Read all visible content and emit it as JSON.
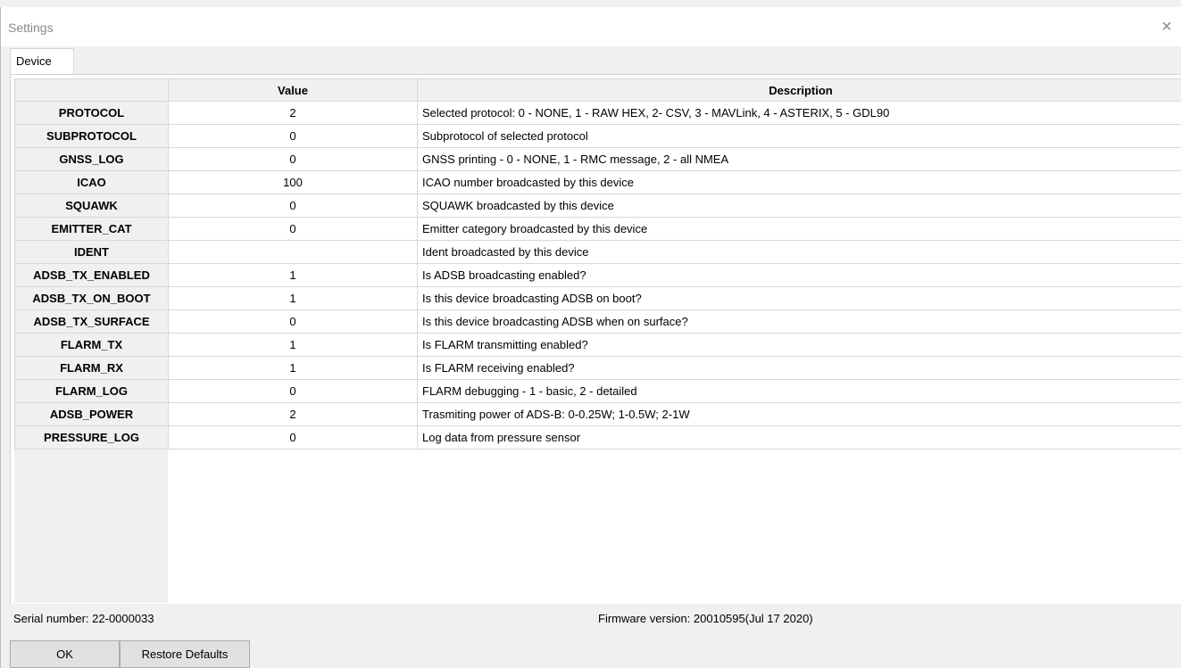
{
  "window": {
    "title": "Settings",
    "close_glyph": "×",
    "close_icon": "close-icon"
  },
  "tabs": [
    {
      "label": "Device",
      "selected": true
    }
  ],
  "table": {
    "columns": [
      "",
      "Value",
      "Description"
    ],
    "rows": [
      {
        "name": "PROTOCOL",
        "value": "2",
        "description": "Selected protocol: 0 - NONE, 1 - RAW HEX, 2- CSV, 3 - MAVLink, 4 - ASTERIX, 5 - GDL90"
      },
      {
        "name": "SUBPROTOCOL",
        "value": "0",
        "description": "Subprotocol of selected protocol"
      },
      {
        "name": "GNSS_LOG",
        "value": "0",
        "description": "GNSS printing - 0 - NONE, 1 - RMC message, 2 - all NMEA"
      },
      {
        "name": "ICAO",
        "value": "100",
        "description": "ICAO number broadcasted by this device"
      },
      {
        "name": "SQUAWK",
        "value": "0",
        "description": "SQUAWK broadcasted by this device"
      },
      {
        "name": "EMITTER_CAT",
        "value": "0",
        "description": "Emitter category broadcasted by this device"
      },
      {
        "name": "IDENT",
        "value": "",
        "description": "Ident broadcasted by this device"
      },
      {
        "name": "ADSB_TX_ENABLED",
        "value": "1",
        "description": "Is ADSB broadcasting enabled?"
      },
      {
        "name": "ADSB_TX_ON_BOOT",
        "value": "1",
        "description": "Is this device broadcasting ADSB on boot?"
      },
      {
        "name": "ADSB_TX_SURFACE",
        "value": "0",
        "description": "Is this device broadcasting ADSB when on surface?"
      },
      {
        "name": "FLARM_TX",
        "value": "1",
        "description": "Is FLARM transmitting enabled?"
      },
      {
        "name": "FLARM_RX",
        "value": "1",
        "description": "Is FLARM receiving enabled?"
      },
      {
        "name": "FLARM_LOG",
        "value": "0",
        "description": "FLARM debugging - 1 - basic, 2 - detailed"
      },
      {
        "name": "ADSB_POWER",
        "value": "2",
        "description": "Trasmiting power of ADS-B: 0-0.25W; 1-0.5W; 2-1W"
      },
      {
        "name": "PRESSURE_LOG",
        "value": "0",
        "description": "Log data from pressure sensor"
      }
    ]
  },
  "status": {
    "serial": "Serial number: 22-0000033",
    "firmware": "Firmware version: 20010595(Jul 17 2020)"
  },
  "buttons": {
    "ok": "OK",
    "restore": "Restore Defaults"
  }
}
